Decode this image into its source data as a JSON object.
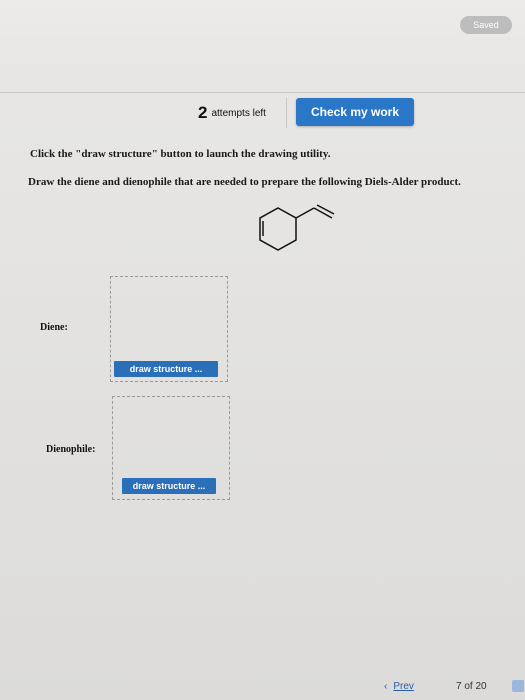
{
  "header": {
    "status_badge": "Saved"
  },
  "attempts": {
    "count": "2",
    "label": "attempts left"
  },
  "check_button": {
    "label": "Check my work"
  },
  "instructions": {
    "line1": "Click the \"draw structure\" button to launch the drawing utility.",
    "line2": "Draw the diene and dienophile that are needed to prepare the following Diels-Alder product."
  },
  "fields": [
    {
      "label": "Diene:",
      "button": "draw structure ..."
    },
    {
      "label": "Dienophile:",
      "button": "draw structure ..."
    }
  ],
  "footer": {
    "prev_label": "Prev",
    "page_current": "7",
    "page_of": "of",
    "page_total": "20"
  },
  "colors": {
    "accent": "#2a77c8",
    "badge": "#bdbdbd"
  }
}
